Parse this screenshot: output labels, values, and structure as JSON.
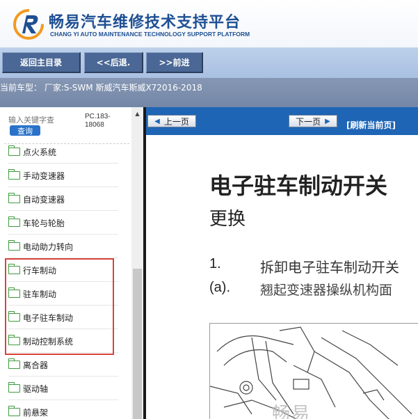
{
  "header": {
    "title_cn": "畅易汽车维修技术支持平台",
    "title_en": "CHANG YI AUTO MAINTENANCE TECHNOLOGY SUPPORT PLATFORM"
  },
  "nav": {
    "home_label": "返回主目录",
    "back_label": "<<后退.",
    "forward_label": ">>前进"
  },
  "vehicle_bar": {
    "text": "当前车型：  厂家:S-SWM 斯威汽车斯威X72016-2018"
  },
  "sidebar": {
    "search_placeholder": "输入关键字查",
    "search_button": "查询",
    "code": "PC.183-18068",
    "items": [
      {
        "label": "点火系统"
      },
      {
        "label": "手动变速器"
      },
      {
        "label": "自动变速器"
      },
      {
        "label": "车轮与轮胎"
      },
      {
        "label": "电动助力转向"
      },
      {
        "label": "行车制动"
      },
      {
        "label": "驻车制动"
      },
      {
        "label": "电子驻车制动"
      },
      {
        "label": "制动控制系统"
      },
      {
        "label": "离合器"
      },
      {
        "label": "驱动轴"
      },
      {
        "label": "前悬架"
      }
    ]
  },
  "content": {
    "prev_page": "上一页",
    "next_page": "下一页",
    "refresh": "[刷新当前页]",
    "title": "电子驻车制动开关",
    "subtitle": "更换",
    "steps": [
      {
        "num": "1.",
        "text": "拆卸电子驻车制动开关"
      },
      {
        "num": "(a).",
        "text": "翘起变速器操纵机构面"
      }
    ],
    "watermark": "畅易"
  },
  "colors": {
    "brand_blue": "#1e4f93",
    "nav_button": "#4a6795",
    "page_nav_blue": "#1e65b5",
    "highlight_red": "#d9433a",
    "folder_green": "#3f9a3f"
  }
}
